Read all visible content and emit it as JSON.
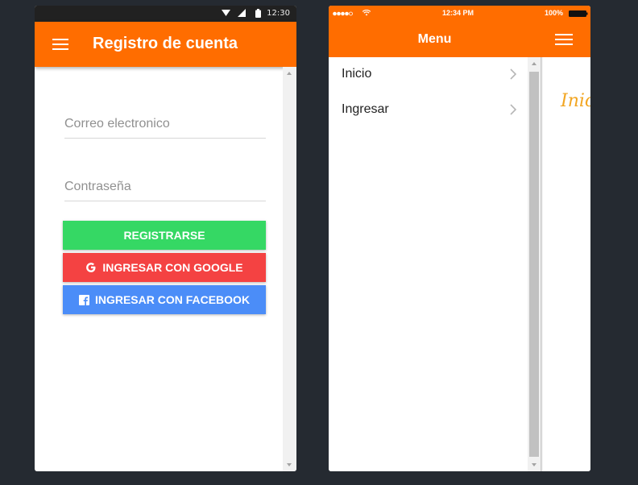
{
  "android": {
    "status_time": "12:30",
    "toolbar_title": "Registro de cuenta",
    "email_placeholder": "Correo electronico",
    "password_placeholder": "Contraseña",
    "register_label": "REGISTRARSE",
    "google_label": "INGRESAR CON GOOGLE",
    "facebook_label": "INGRESAR CON FACEBOOK",
    "colors": {
      "toolbar": "#ff6d00",
      "register": "#35d864",
      "google": "#f44242",
      "facebook": "#4b8df8"
    }
  },
  "ios": {
    "status_time": "12:34 PM",
    "battery": "100%",
    "menu_title": "Menu",
    "menu_items": [
      {
        "label": "Inicio"
      },
      {
        "label": "Ingresar"
      }
    ],
    "page_title": "Inicio",
    "colors": {
      "header": "#ff6d00",
      "title_text": "#f2a623"
    }
  }
}
